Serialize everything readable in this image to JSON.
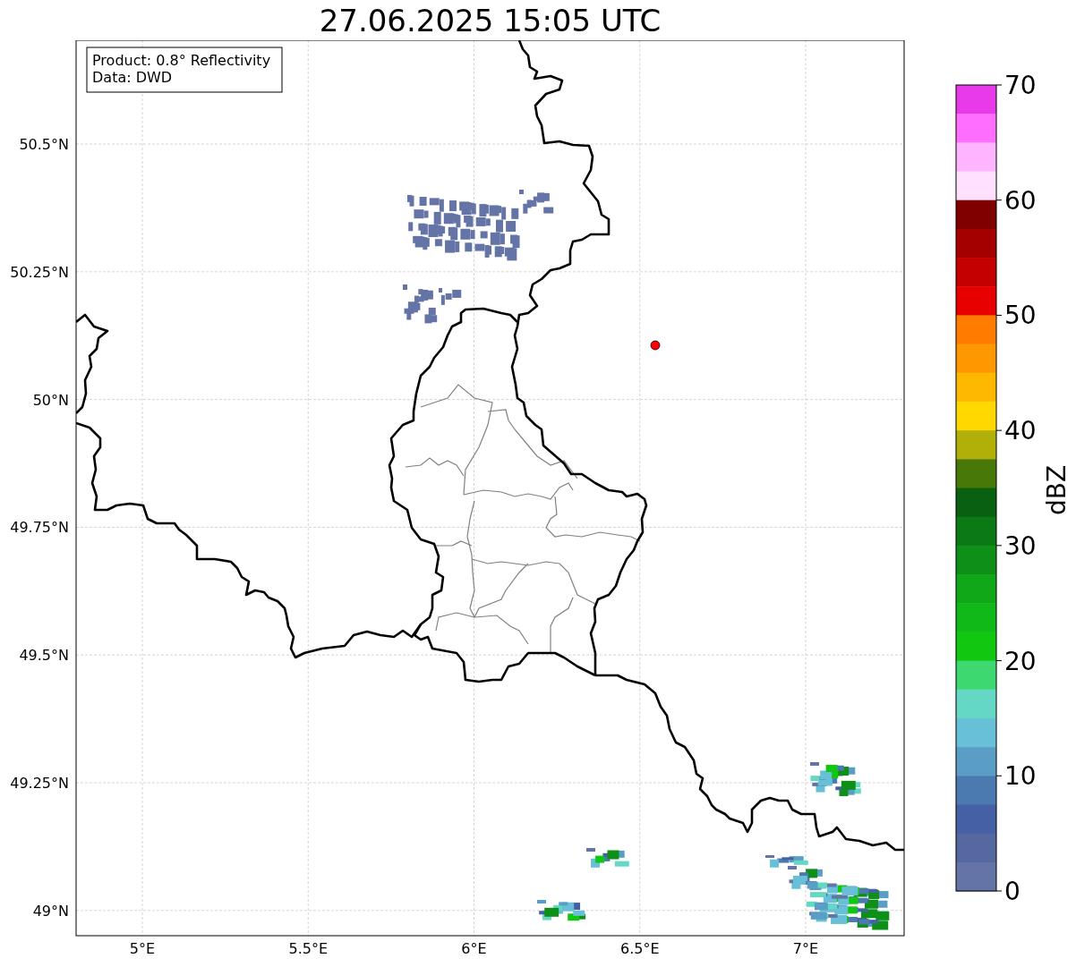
{
  "title": "27.06.2025 15:05 UTC",
  "legend": [
    "Product: 0.8° Reflectivity",
    "Data: DWD"
  ],
  "map": {
    "lat_ticks": [
      "50.5°N",
      "50.25°N",
      "50°N",
      "49.75°N",
      "49.5°N",
      "49.25°N",
      "49°N"
    ],
    "lon_ticks": [
      "5°E",
      "5.5°E",
      "6°E",
      "6.5°E",
      "7°E"
    ]
  },
  "colorbar": {
    "label": "dBZ",
    "ticks": [
      "70",
      "60",
      "50",
      "40",
      "30",
      "20",
      "10",
      "0"
    ],
    "bins": [
      {
        "color": "#e83ae8"
      },
      {
        "color": "#ff6eff"
      },
      {
        "color": "#ffb4ff"
      },
      {
        "color": "#ffe0ff"
      },
      {
        "color": "#800000"
      },
      {
        "color": "#a40000"
      },
      {
        "color": "#c40000"
      },
      {
        "color": "#e80000"
      },
      {
        "color": "#ff7c00"
      },
      {
        "color": "#ff9800"
      },
      {
        "color": "#ffb800"
      },
      {
        "color": "#ffd800"
      },
      {
        "color": "#b0b008"
      },
      {
        "color": "#487808"
      },
      {
        "color": "#086010"
      },
      {
        "color": "#0c7a14"
      },
      {
        "color": "#0e9018"
      },
      {
        "color": "#10a818"
      },
      {
        "color": "#10b818"
      },
      {
        "color": "#10c810"
      },
      {
        "color": "#3ed870"
      },
      {
        "color": "#64d8c4"
      },
      {
        "color": "#68c0d8"
      },
      {
        "color": "#5a9ec6"
      },
      {
        "color": "#4a7ab0"
      },
      {
        "color": "#4560a4"
      },
      {
        "color": "#5569a0"
      },
      {
        "color": "#6474a6"
      }
    ]
  }
}
